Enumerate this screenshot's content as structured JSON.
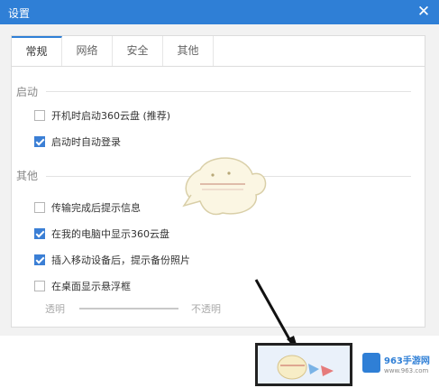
{
  "window": {
    "title": "设置",
    "close_glyph": "✕"
  },
  "tabs": [
    {
      "label": "常规",
      "active": true
    },
    {
      "label": "网络",
      "active": false
    },
    {
      "label": "安全",
      "active": false
    },
    {
      "label": "其他",
      "active": false
    }
  ],
  "sections": [
    {
      "title": "启动",
      "options": [
        {
          "label": "开机时启动360云盘 (推荐)",
          "checked": false
        },
        {
          "label": "启动时自动登录",
          "checked": true
        }
      ]
    },
    {
      "title": "其他",
      "options": [
        {
          "label": "传输完成后提示信息",
          "checked": false
        },
        {
          "label": "在我的电脑中显示360云盘",
          "checked": true
        },
        {
          "label": "插入移动设备后，提示备份照片",
          "checked": true
        },
        {
          "label": "在桌面显示悬浮框",
          "checked": false
        }
      ]
    }
  ],
  "opacity": {
    "left_label": "透明",
    "right_label": "不透明"
  },
  "watermark": {
    "brand": "963手游网",
    "url": "www.963.com"
  },
  "colors": {
    "accent": "#2f7fd6",
    "check": "#3b7fd5"
  }
}
